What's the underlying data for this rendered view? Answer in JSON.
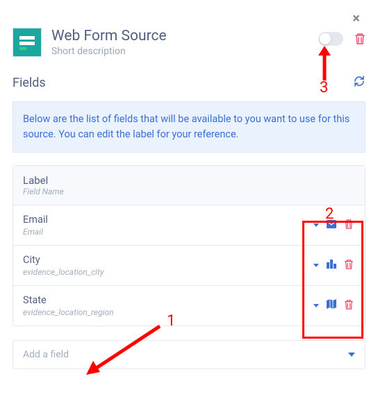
{
  "close_label": "×",
  "header": {
    "title": "Web Form Source",
    "subtitle": "Short description"
  },
  "section": {
    "title": "Fields",
    "info": "Below are the list of fields that will be available to you want to use for this source. You can edit the label for your reference."
  },
  "table": {
    "head_label": "Label",
    "head_sub": "Field Name",
    "rows": [
      {
        "label": "Email",
        "name": "Email"
      },
      {
        "label": "City",
        "name": "evidence_location_city"
      },
      {
        "label": "State",
        "name": "evidence_location_region"
      }
    ]
  },
  "add_field_placeholder": "Add a field",
  "annotations": {
    "n1": "1",
    "n2": "2",
    "n3": "3"
  }
}
